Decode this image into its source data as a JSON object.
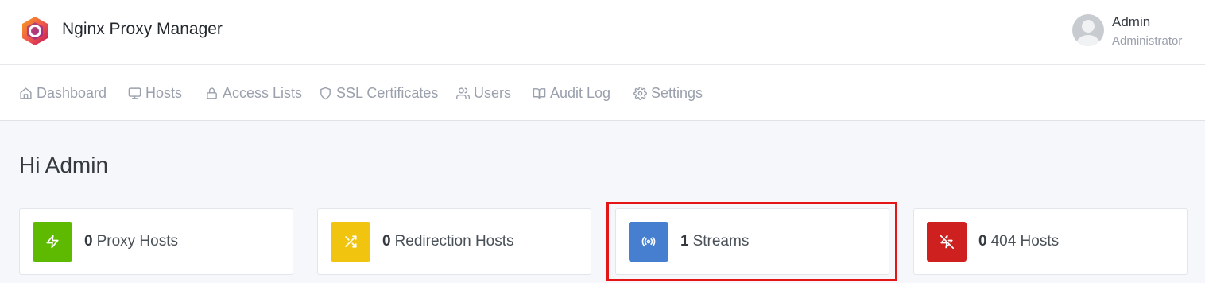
{
  "header": {
    "app_title": "Nginx Proxy Manager",
    "logo_icon": "nginx-proxy-manager-logo",
    "user": {
      "name": "Admin",
      "role": "Administrator"
    }
  },
  "nav": {
    "items": [
      {
        "label": "Dashboard",
        "icon": "home-icon"
      },
      {
        "label": "Hosts",
        "icon": "monitor-icon"
      },
      {
        "label": "Access Lists",
        "icon": "lock-icon"
      },
      {
        "label": "SSL Certificates",
        "icon": "shield-icon"
      },
      {
        "label": "Users",
        "icon": "users-icon"
      },
      {
        "label": "Audit Log",
        "icon": "book-icon"
      },
      {
        "label": "Settings",
        "icon": "gear-icon"
      }
    ]
  },
  "main": {
    "greeting": "Hi Admin",
    "stats": [
      {
        "count": "0",
        "label": "Proxy Hosts",
        "color": "#5eba00",
        "icon": "zap-icon"
      },
      {
        "count": "0",
        "label": "Redirection Hosts",
        "color": "#f1c40f",
        "icon": "shuffle-icon"
      },
      {
        "count": "1",
        "label": "Streams",
        "color": "#467fcf",
        "icon": "radio-icon"
      },
      {
        "count": "0",
        "label": "404 Hosts",
        "color": "#cd201f",
        "icon": "zap-off-icon"
      }
    ]
  },
  "annotation": {
    "color": "#e51515"
  }
}
